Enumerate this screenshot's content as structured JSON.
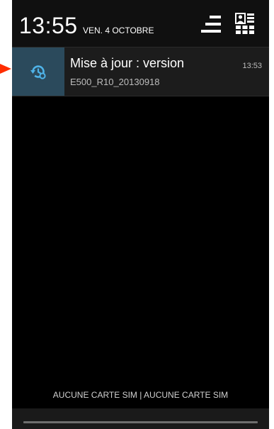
{
  "status_bar": {
    "time": "13:55",
    "date": "VEN. 4 OCTOBRE"
  },
  "notification": {
    "title": "Mise à jour : version",
    "subtitle": "E500_R10_20130918",
    "time": "13:53",
    "icon": "system-update-icon",
    "accent_color": "#2b4a5c"
  },
  "carrier_label": "AUCUNE CARTE SIM | AUCUNE CARTE SIM",
  "annotation": {
    "arrow_color": "#ff2d00"
  }
}
